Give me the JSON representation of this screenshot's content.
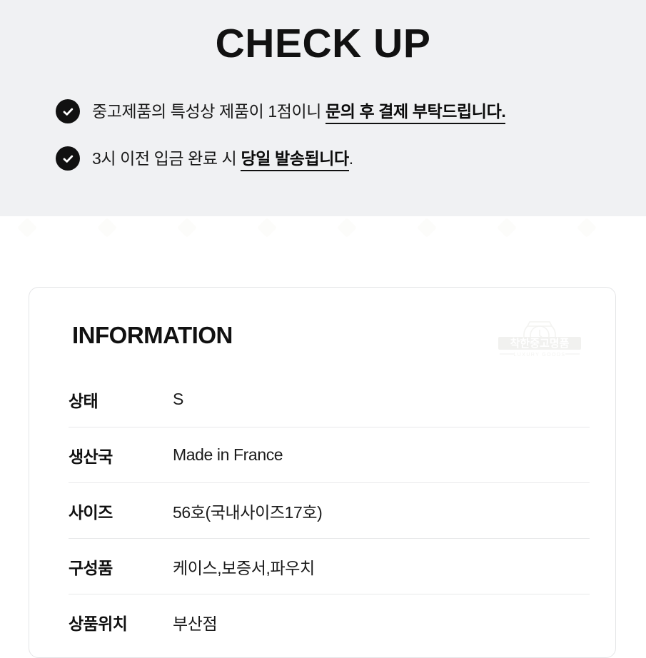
{
  "header": {
    "title": "CHECK UP",
    "background_color": "#f0f1f3",
    "notices": [
      {
        "icon": "check-circle-icon",
        "text_plain": "중고제품의 특성상 제품이 1점이니 ",
        "text_emphasis": "문의 후 결제 부탁드립니다."
      },
      {
        "icon": "check-circle-icon",
        "text_plain": "3시 이전 입금 완료 시 ",
        "text_emphasis": "당일 발송됩니다",
        "text_tail": "."
      }
    ]
  },
  "information": {
    "heading": "INFORMATION",
    "watermark": {
      "brand": "착한중고명품",
      "tagline": "LUXURY GOODS",
      "icon": "watch-icon"
    },
    "rows": [
      {
        "label": "상태",
        "value": "S"
      },
      {
        "label": "생산국",
        "value": "Made in France"
      },
      {
        "label": "사이즈",
        "value": "56호(국내사이즈17호)"
      },
      {
        "label": "구성품",
        "value": "케이스,보증서,파우치"
      },
      {
        "label": "상품위치",
        "value": "부산점"
      }
    ]
  },
  "colors": {
    "text": "#111111",
    "band": "#f0f1f3",
    "divider": "#e8e9ea",
    "card_border": "#e4e5e7"
  }
}
